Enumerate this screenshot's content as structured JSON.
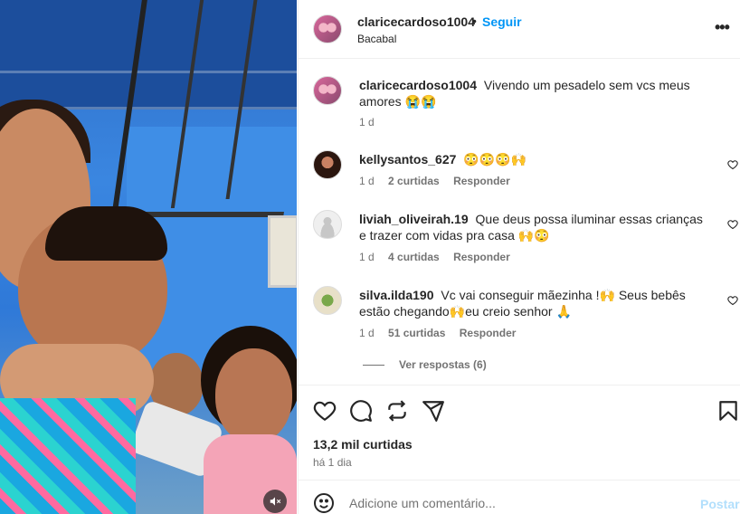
{
  "post": {
    "username": "claricecardoso1004",
    "separator": "•",
    "follow_label": "Seguir",
    "location": "Bacabal",
    "more_label": "•••"
  },
  "caption": {
    "username": "claricecardoso1004",
    "text": "Vivendo um pesadelo sem vcs meus amores 😭😭",
    "time": "1 d"
  },
  "comments": [
    {
      "username": "kellysantos_627",
      "text": "😳😳😳🙌",
      "time": "1 d",
      "likes": "2 curtidas",
      "reply": "Responder"
    },
    {
      "username": "liviah_oliveirah.19",
      "text": "Que deus possa iluminar essas crianças e trazer com vidas pra casa 🙌😳",
      "time": "1 d",
      "likes": "4 curtidas",
      "reply": "Responder"
    },
    {
      "username": "silva.ilda190",
      "text": "Vc vai conseguir mãezinha !🙌 Seus bebês estão chegando🙌eu creio senhor 🙏",
      "time": "1 d",
      "likes": "51 curtidas",
      "reply": "Responder"
    }
  ],
  "view_replies": "Ver respostas (6)",
  "likes_count": "13,2 mil curtidas",
  "posted_time": "há 1 dia",
  "comment_input": {
    "placeholder": "Adicione um comentário...",
    "value": ""
  },
  "post_button": "Postar",
  "photo": {
    "mute_icon": "speaker-muted-icon"
  }
}
